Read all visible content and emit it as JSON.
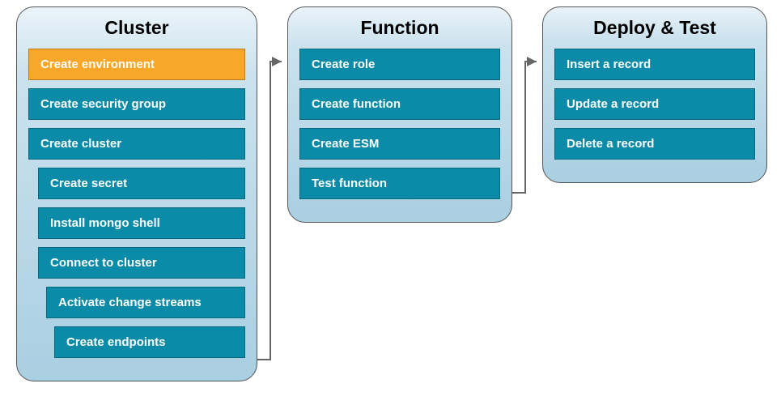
{
  "panels": {
    "cluster": {
      "title": "Cluster",
      "items": [
        {
          "label": "Create environment",
          "active": true
        },
        {
          "label": "Create security group"
        },
        {
          "label": "Create cluster"
        },
        {
          "label": "Create secret"
        },
        {
          "label": "Install mongo shell"
        },
        {
          "label": "Connect to cluster"
        },
        {
          "label": "Activate change streams"
        },
        {
          "label": "Create endpoints"
        }
      ]
    },
    "function": {
      "title": "Function",
      "items": [
        {
          "label": "Create role"
        },
        {
          "label": "Create function"
        },
        {
          "label": "Create ESM"
        },
        {
          "label": "Test function"
        }
      ]
    },
    "deploy": {
      "title": "Deploy & Test",
      "items": [
        {
          "label": "Insert a record"
        },
        {
          "label": "Update a record"
        },
        {
          "label": "Delete a record"
        }
      ]
    }
  },
  "colors": {
    "item_bg": "#0b8ba8",
    "item_active_bg": "#f8a728",
    "panel_border": "#555555"
  }
}
